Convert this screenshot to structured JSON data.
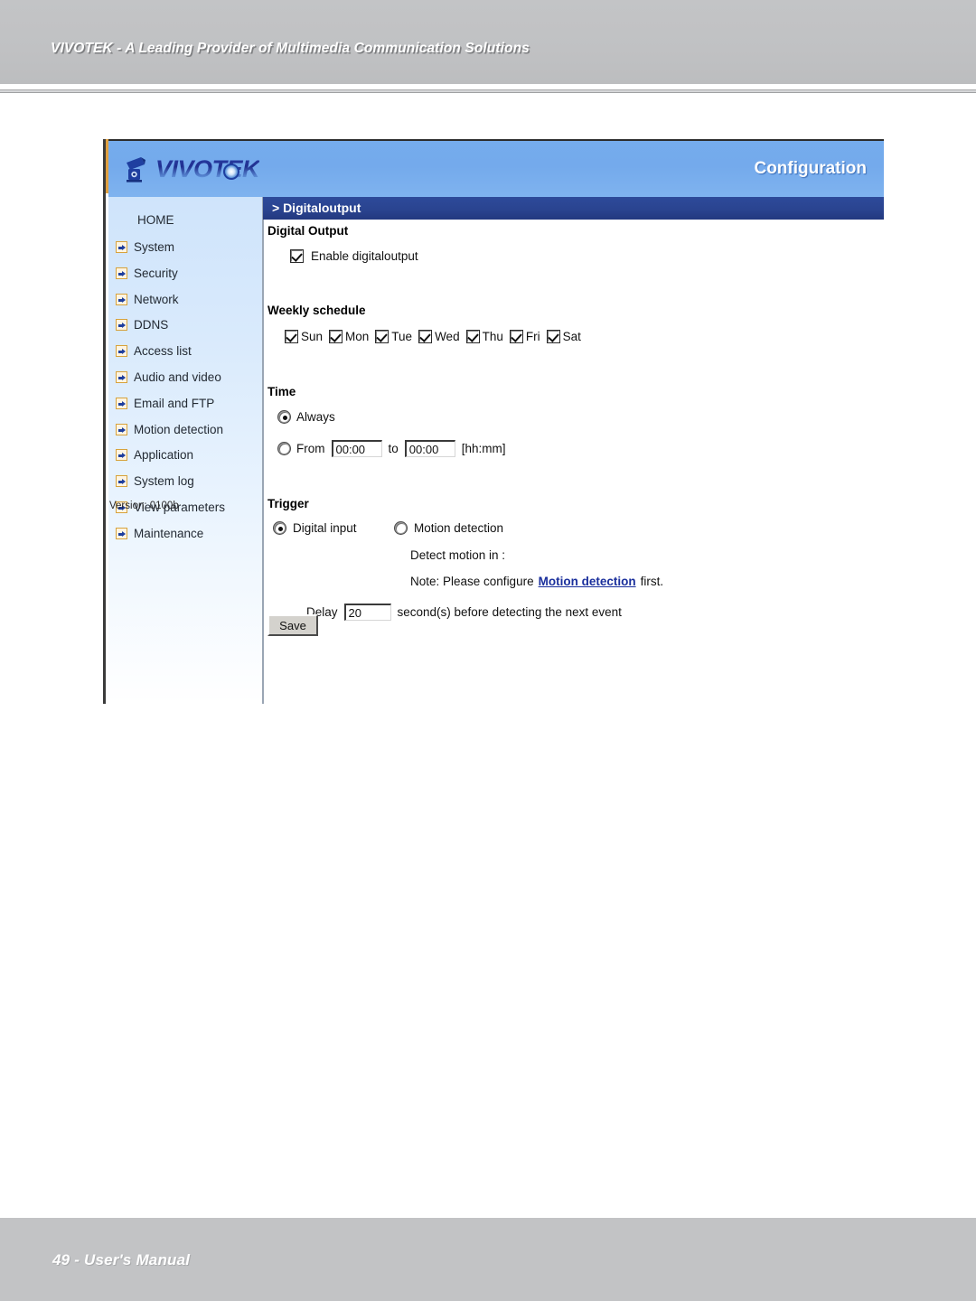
{
  "document": {
    "header_title": "VIVOTEK - A Leading Provider of Multimedia Communication Solutions",
    "footer_text": "49 - User's Manual"
  },
  "app": {
    "brand": "VIVOTEK",
    "brand_icon": "camera-icon",
    "lens_icon": "camera-lens-icon",
    "mode_label": "Configuration",
    "page_title": "> Digitaloutput",
    "version": "Version: 0100b"
  },
  "sidebar": {
    "home_label": "HOME",
    "items": [
      {
        "label": "System",
        "icon": "arrow-right-icon"
      },
      {
        "label": "Security",
        "icon": "arrow-right-icon"
      },
      {
        "label": "Network",
        "icon": "arrow-right-icon"
      },
      {
        "label": "DDNS",
        "icon": "arrow-right-icon"
      },
      {
        "label": "Access list",
        "icon": "arrow-right-icon"
      },
      {
        "label": "Audio and video",
        "icon": "arrow-right-icon"
      },
      {
        "label": "Email and FTP",
        "icon": "arrow-right-icon"
      },
      {
        "label": "Motion detection",
        "icon": "arrow-right-icon"
      },
      {
        "label": "Application",
        "icon": "arrow-right-icon"
      },
      {
        "label": "System log",
        "icon": "arrow-right-icon"
      },
      {
        "label": "View parameters",
        "icon": "arrow-right-icon"
      },
      {
        "label": "Maintenance",
        "icon": "arrow-right-icon"
      }
    ]
  },
  "main": {
    "digital_output": {
      "heading": "Digital Output",
      "enable_label": "Enable digitaloutput",
      "enable_checked": true
    },
    "weekly_schedule": {
      "heading": "Weekly schedule",
      "days": [
        {
          "label": "Sun",
          "checked": true
        },
        {
          "label": "Mon",
          "checked": true
        },
        {
          "label": "Tue",
          "checked": true
        },
        {
          "label": "Wed",
          "checked": true
        },
        {
          "label": "Thu",
          "checked": true
        },
        {
          "label": "Fri",
          "checked": true
        },
        {
          "label": "Sat",
          "checked": true
        }
      ]
    },
    "time": {
      "heading": "Time",
      "always_label": "Always",
      "always_selected": true,
      "from_label": "From",
      "from_value": "00:00",
      "to_label": "to",
      "to_value": "00:00",
      "format_hint": "[hh:mm]",
      "range_selected": false
    },
    "trigger": {
      "heading": "Trigger",
      "digital_input_label": "Digital input",
      "digital_input_selected": true,
      "motion_detection_label": "Motion detection",
      "motion_detection_selected": false,
      "detect_motion_label": "Detect motion in :",
      "note_prefix": "Note: Please configure",
      "note_link": "Motion detection",
      "note_suffix": "first.",
      "delay_label": "Delay",
      "delay_value": "20",
      "delay_suffix": "second(s) before detecting the next event"
    },
    "save_label": "Save"
  },
  "colors": {
    "brand_blue": "#75aced",
    "title_blue": "#2a4490",
    "accent_orange": "#d7a23c",
    "link_blue": "#1a2f9c",
    "doc_gray": "#c2c3c5"
  }
}
